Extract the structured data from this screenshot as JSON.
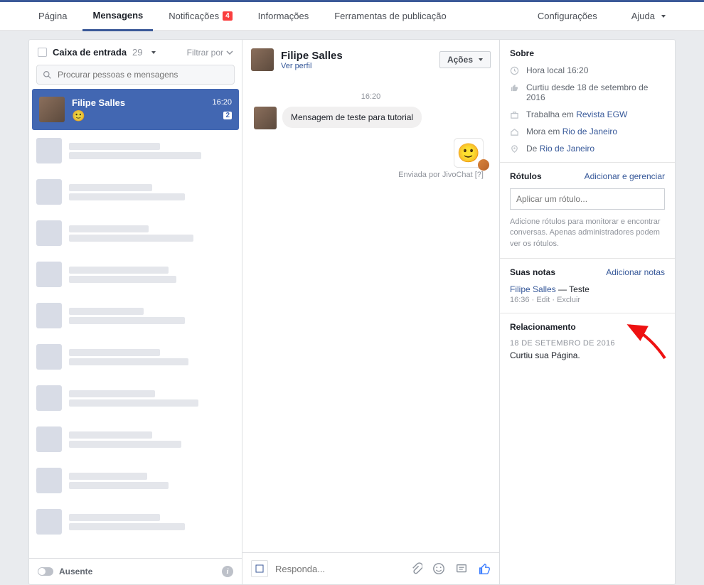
{
  "topnav": {
    "pagina": "Página",
    "mensagens": "Mensagens",
    "notificacoes": "Notificações",
    "notif_count": "4",
    "informacoes": "Informações",
    "ferramentas": "Ferramentas de publicação",
    "config": "Configurações",
    "ajuda": "Ajuda"
  },
  "inbox": {
    "title": "Caixa de entrada",
    "count": "29",
    "filter": "Filtrar por",
    "search_placeholder": "Procurar pessoas e mensagens",
    "selected": {
      "name": "Filipe Salles",
      "time": "16:20",
      "unread": "2"
    },
    "presence": "Ausente"
  },
  "thread": {
    "name": "Filipe Salles",
    "view_profile": "Ver perfil",
    "actions": "Ações",
    "time": "16:20",
    "message": "Mensagem de teste para tutorial",
    "sent_by": "Enviada por JivoChat [?]",
    "reply_placeholder": "Responda..."
  },
  "about": {
    "title": "Sobre",
    "local_time": "Hora local 16:20",
    "liked_since": "Curtiu desde 18 de setembro de 2016",
    "works_prefix": "Trabalha em ",
    "works_link": "Revista EGW",
    "lives_prefix": "Mora em ",
    "lives_link": "Rio de Janeiro",
    "from_prefix": "De ",
    "from_link": "Rio de Janeiro"
  },
  "labels": {
    "title": "Rótulos",
    "manage": "Adicionar e gerenciar",
    "placeholder": "Aplicar um rótulo...",
    "help": "Adicione rótulos para monitorar e encontrar conversas. Apenas administradores podem ver os rótulos."
  },
  "notes": {
    "title": "Suas notas",
    "add": "Adicionar notas",
    "author": "Filipe Salles",
    "sep": " — ",
    "text": "Teste",
    "time": "16:36",
    "edit": "Edit",
    "delete": "Excluir"
  },
  "relationship": {
    "title": "Relacionamento",
    "date": "18 DE SETEMBRO DE 2016",
    "text": "Curtiu sua Página."
  }
}
